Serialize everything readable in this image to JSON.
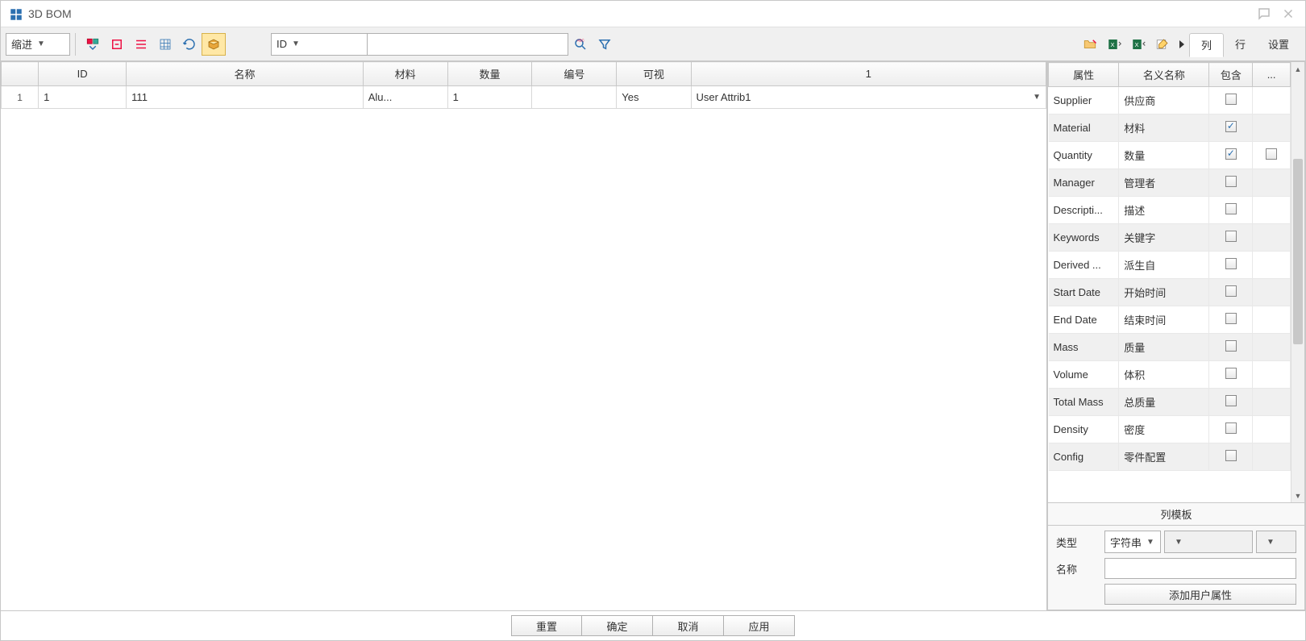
{
  "title": "3D BOM",
  "toolbar": {
    "indent_combo": "缩进",
    "search_field_combo": "ID"
  },
  "right_tabs": {
    "columns": "列",
    "rows": "行",
    "settings": "设置"
  },
  "main_table": {
    "headers": {
      "rownum": "",
      "id": "ID",
      "name": "名称",
      "material": "材料",
      "quantity": "数量",
      "number": "编号",
      "visible": "可视",
      "col1": "1"
    },
    "rows": [
      {
        "rownum": "1",
        "id": "1",
        "name": "111",
        "material": "Alu...",
        "quantity": "1",
        "number": "",
        "visible": "Yes",
        "col1": "User Attrib1"
      }
    ]
  },
  "prop_table": {
    "headers": {
      "attr": "属性",
      "disp_name": "名义名称",
      "include": "包含",
      "more": "..."
    },
    "rows": [
      {
        "attr": "Supplier",
        "disp": "供应商",
        "include": false,
        "more": false,
        "more_shown": false
      },
      {
        "attr": "Material",
        "disp": "材料",
        "include": true,
        "more": false,
        "more_shown": false
      },
      {
        "attr": "Quantity",
        "disp": "数量",
        "include": true,
        "more": false,
        "more_shown": true
      },
      {
        "attr": "Manager",
        "disp": "管理者",
        "include": false,
        "more": false,
        "more_shown": false
      },
      {
        "attr": "Descripti...",
        "disp": "描述",
        "include": false,
        "more": false,
        "more_shown": false
      },
      {
        "attr": "Keywords",
        "disp": "关键字",
        "include": false,
        "more": false,
        "more_shown": false
      },
      {
        "attr": "Derived ...",
        "disp": "派生自",
        "include": false,
        "more": false,
        "more_shown": false
      },
      {
        "attr": "Start Date",
        "disp": "开始时间",
        "include": false,
        "more": false,
        "more_shown": false
      },
      {
        "attr": "End Date",
        "disp": "结束时间",
        "include": false,
        "more": false,
        "more_shown": false
      },
      {
        "attr": "Mass",
        "disp": "质量",
        "include": false,
        "more": false,
        "more_shown": false
      },
      {
        "attr": "Volume",
        "disp": "体积",
        "include": false,
        "more": false,
        "more_shown": false
      },
      {
        "attr": "Total Mass",
        "disp": "总质量",
        "include": false,
        "more": false,
        "more_shown": false
      },
      {
        "attr": "Density",
        "disp": "密度",
        "include": false,
        "more": false,
        "more_shown": false
      },
      {
        "attr": "Config",
        "disp": "零件配置",
        "include": false,
        "more": false,
        "more_shown": false
      }
    ]
  },
  "col_template_label": "列模板",
  "bottom_form": {
    "type_label": "类型",
    "type_value": "字符串",
    "name_label": "名称",
    "name_value": "",
    "add_user_attr_btn": "添加用户属性"
  },
  "footer": {
    "reset": "重置",
    "ok": "确定",
    "cancel": "取消",
    "apply": "应用"
  }
}
